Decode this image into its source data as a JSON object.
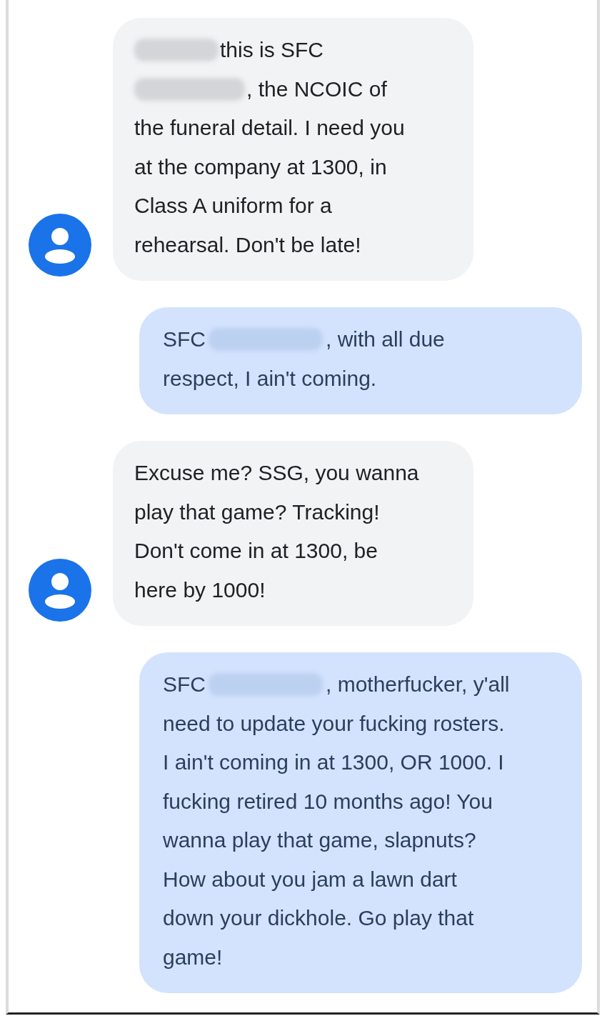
{
  "messages": [
    {
      "kind": "incoming",
      "lines": [
        [
          {
            "kind": "redaction"
          },
          {
            "kind": "text",
            "text": "this is SFC"
          }
        ],
        [
          {
            "kind": "redaction"
          },
          {
            "kind": "text",
            "text": ", the NCOIC of"
          }
        ],
        [
          {
            "kind": "text",
            "text": "the funeral detail. I need you"
          }
        ],
        [
          {
            "kind": "text",
            "text": "at the company at 1300, in"
          }
        ],
        [
          {
            "kind": "text",
            "text": "Class A uniform for a"
          }
        ],
        [
          {
            "kind": "text",
            "text": "rehearsal. Don't be late!"
          }
        ]
      ]
    },
    {
      "kind": "outgoing",
      "lines": [
        [
          {
            "kind": "text",
            "text": "SFC"
          },
          {
            "kind": "redaction"
          },
          {
            "kind": "text",
            "text": ", with all due"
          }
        ],
        [
          {
            "kind": "text",
            "text": "respect, I ain't coming."
          }
        ]
      ]
    },
    {
      "kind": "incoming",
      "lines": [
        [
          {
            "kind": "text",
            "text": "Excuse me? SSG, you wanna"
          }
        ],
        [
          {
            "kind": "text",
            "text": "play that game? Tracking!"
          }
        ],
        [
          {
            "kind": "text",
            "text": "Don't come in at 1300, be"
          }
        ],
        [
          {
            "kind": "text",
            "text": "here by 1000!"
          }
        ]
      ]
    },
    {
      "kind": "outgoing",
      "lines": [
        [
          {
            "kind": "text",
            "text": "SFC"
          },
          {
            "kind": "redaction"
          },
          {
            "kind": "text",
            "text": ", motherfucker, y'all"
          }
        ],
        [
          {
            "kind": "text",
            "text": "need to update your fucking rosters."
          }
        ],
        [
          {
            "kind": "text",
            "text": "I ain't coming in at 1300, OR 1000. I"
          }
        ],
        [
          {
            "kind": "text",
            "text": "fucking retired 10 months ago! You"
          }
        ],
        [
          {
            "kind": "text",
            "text": "wanna play that game, slapnuts?"
          }
        ],
        [
          {
            "kind": "text",
            "text": "How about you jam a lawn dart"
          }
        ],
        [
          {
            "kind": "text",
            "text": "down your dickhole. Go play that"
          }
        ],
        [
          {
            "kind": "text",
            "text": "game!"
          }
        ]
      ]
    }
  ]
}
